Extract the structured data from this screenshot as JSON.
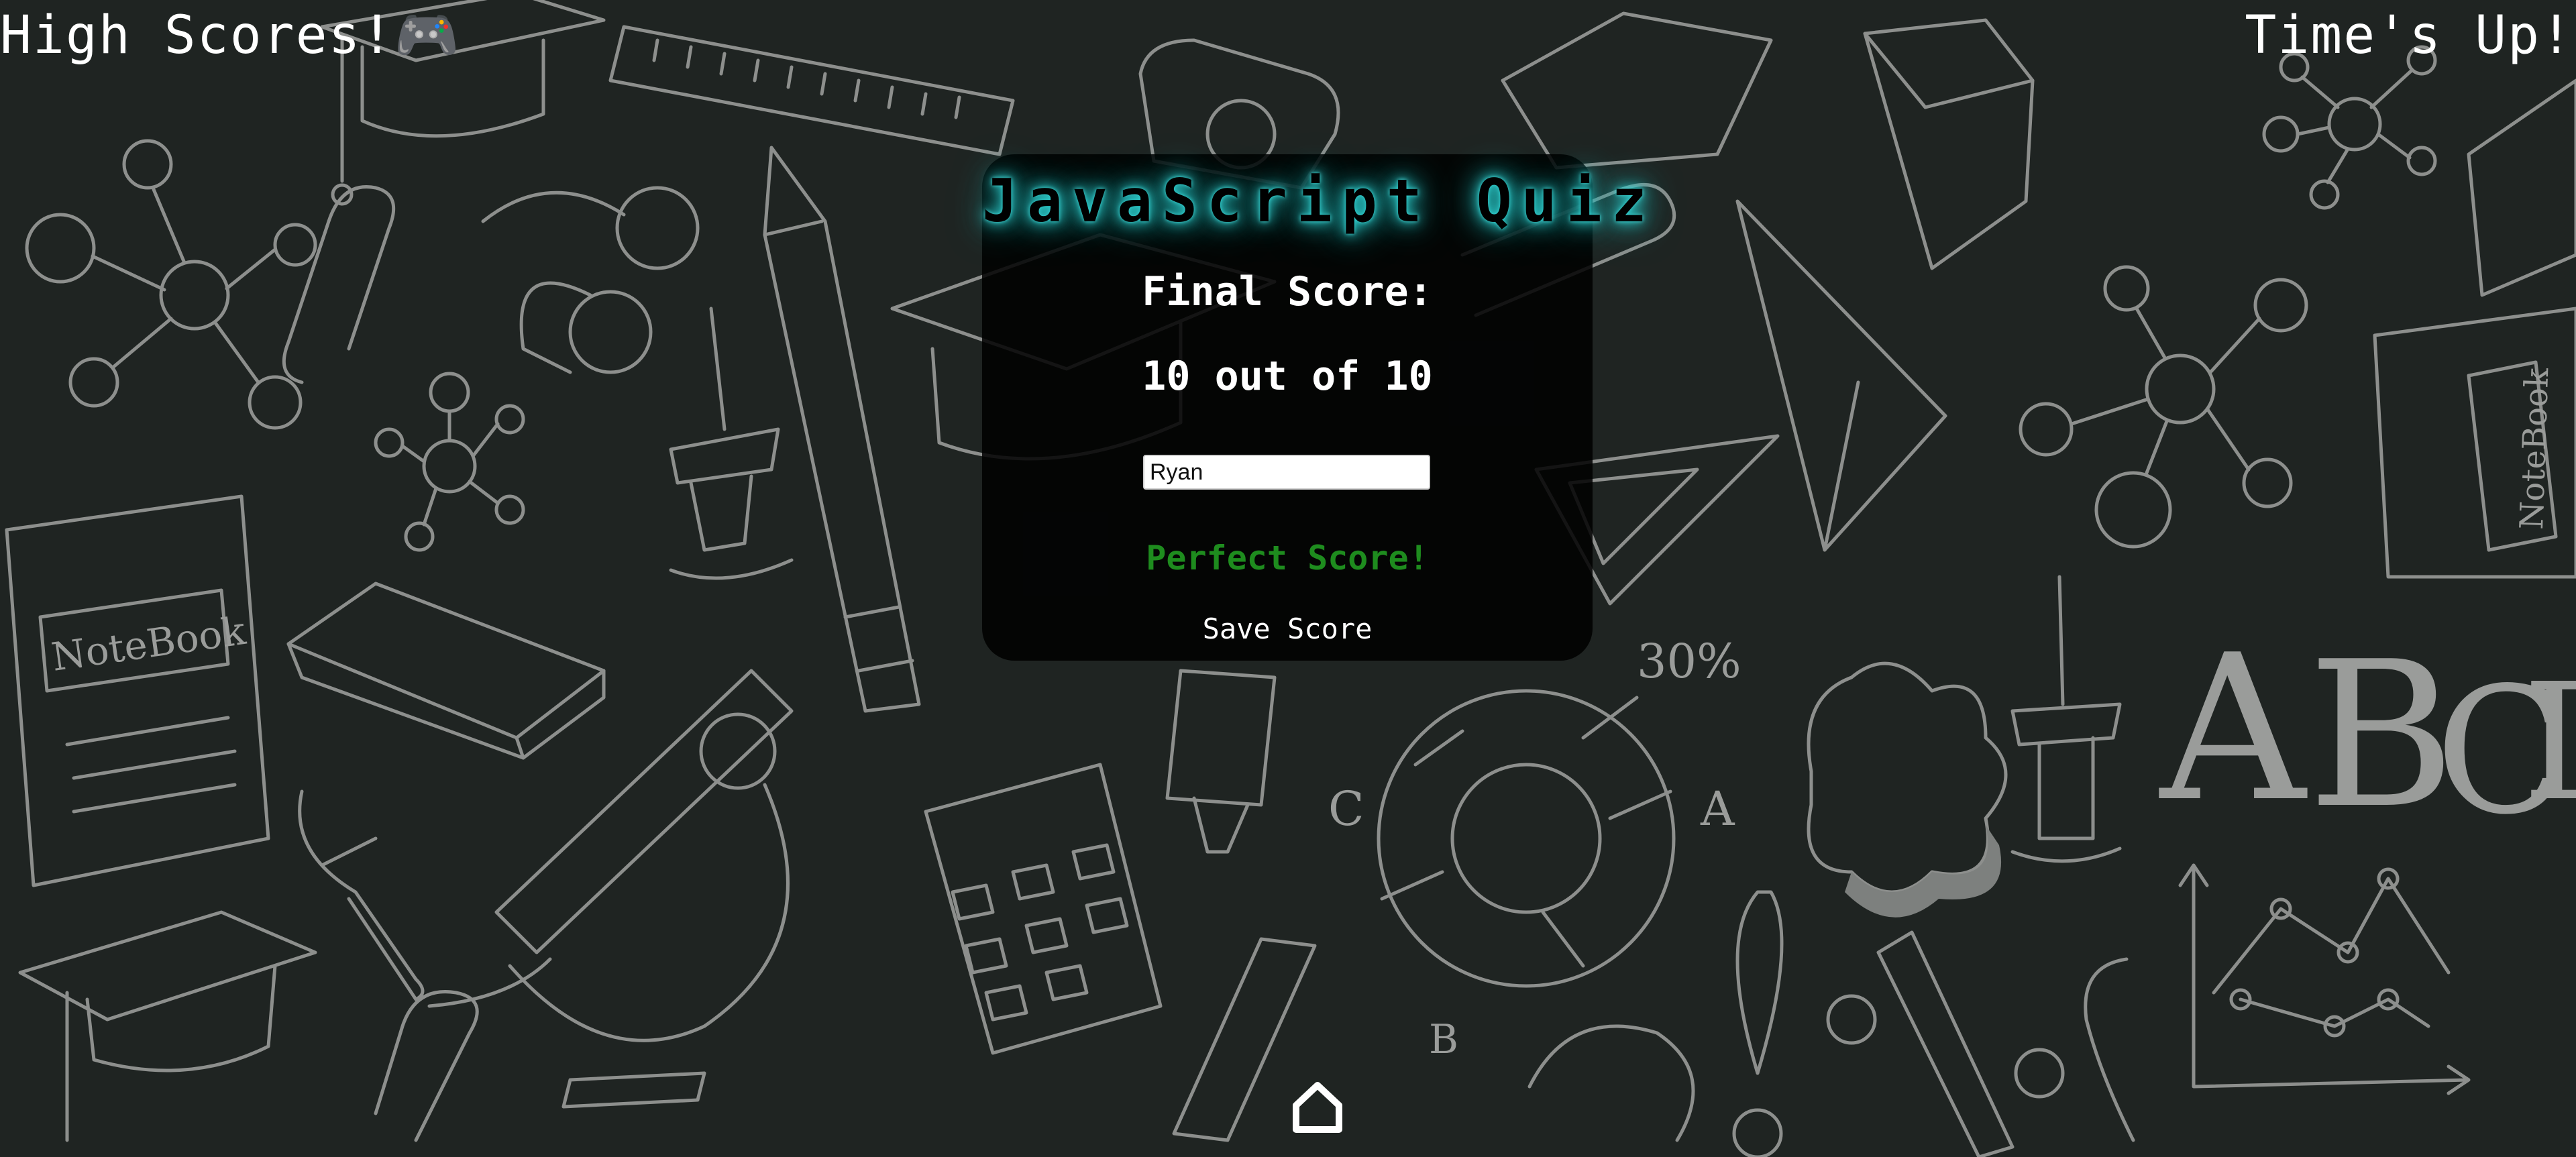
{
  "header": {
    "high_scores_label": "High Scores!🎮",
    "timer_label": "Time's Up!"
  },
  "quiz": {
    "title": "JavaScript Quiz",
    "final_score_label": "Final Score:",
    "final_score_value": "10 out of 10",
    "name_input_value": "Ryan",
    "status_message": "Perfect Score!",
    "save_button_label": "Save Score"
  },
  "background": {
    "notebook_left_label": "NoteBook",
    "notebook_right_label": "NoteBook",
    "percent_label": "30%",
    "letters": [
      "A",
      "B",
      "C",
      "D"
    ],
    "chart_letters": [
      "C",
      "A",
      "B"
    ],
    "icon": "chalkboard-doodles"
  },
  "footer": {
    "home_icon": "home-icon"
  },
  "colors": {
    "background": "#1f2422",
    "card": "#000000",
    "title_glow": "#2fd6d6",
    "success": "#1e8c1e",
    "text": "#ffffff"
  }
}
